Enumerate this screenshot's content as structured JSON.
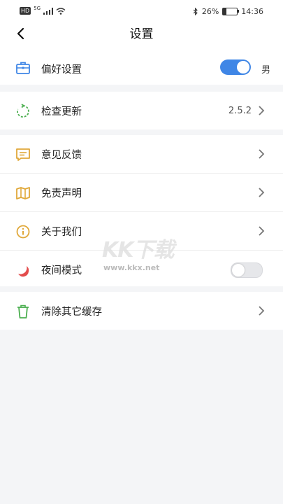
{
  "status_bar": {
    "network_badge": "HD",
    "network_type": "5G",
    "battery": "26%",
    "time": "14:36",
    "battery_level": 0.26
  },
  "header": {
    "title": "设置"
  },
  "sections": [
    {
      "items": [
        {
          "label": "偏好设置",
          "toggle_label": "男",
          "toggle_on": true,
          "icon": "briefcase-icon"
        }
      ]
    },
    {
      "items": [
        {
          "label": "检查更新",
          "value": "2.5.2",
          "icon": "refresh-icon"
        }
      ]
    },
    {
      "items": [
        {
          "label": "意见反馈",
          "icon": "feedback-icon"
        },
        {
          "label": "免责声明",
          "icon": "map-icon"
        },
        {
          "label": "关于我们",
          "icon": "info-icon"
        },
        {
          "label": "夜间模式",
          "toggle_on": false,
          "icon": "moon-icon"
        }
      ]
    },
    {
      "items": [
        {
          "label": "清除其它缓存",
          "icon": "trash-icon"
        }
      ]
    }
  ],
  "watermark": {
    "logo": "KK下载",
    "url": "www.kkx.net"
  },
  "colors": {
    "accent": "#3f86e6",
    "briefcase": "#3f86e6",
    "refresh": "#4caf50",
    "feedback": "#e0a83a",
    "info": "#e0a83a",
    "moon": "#e34c4c",
    "trash": "#4caf50"
  }
}
